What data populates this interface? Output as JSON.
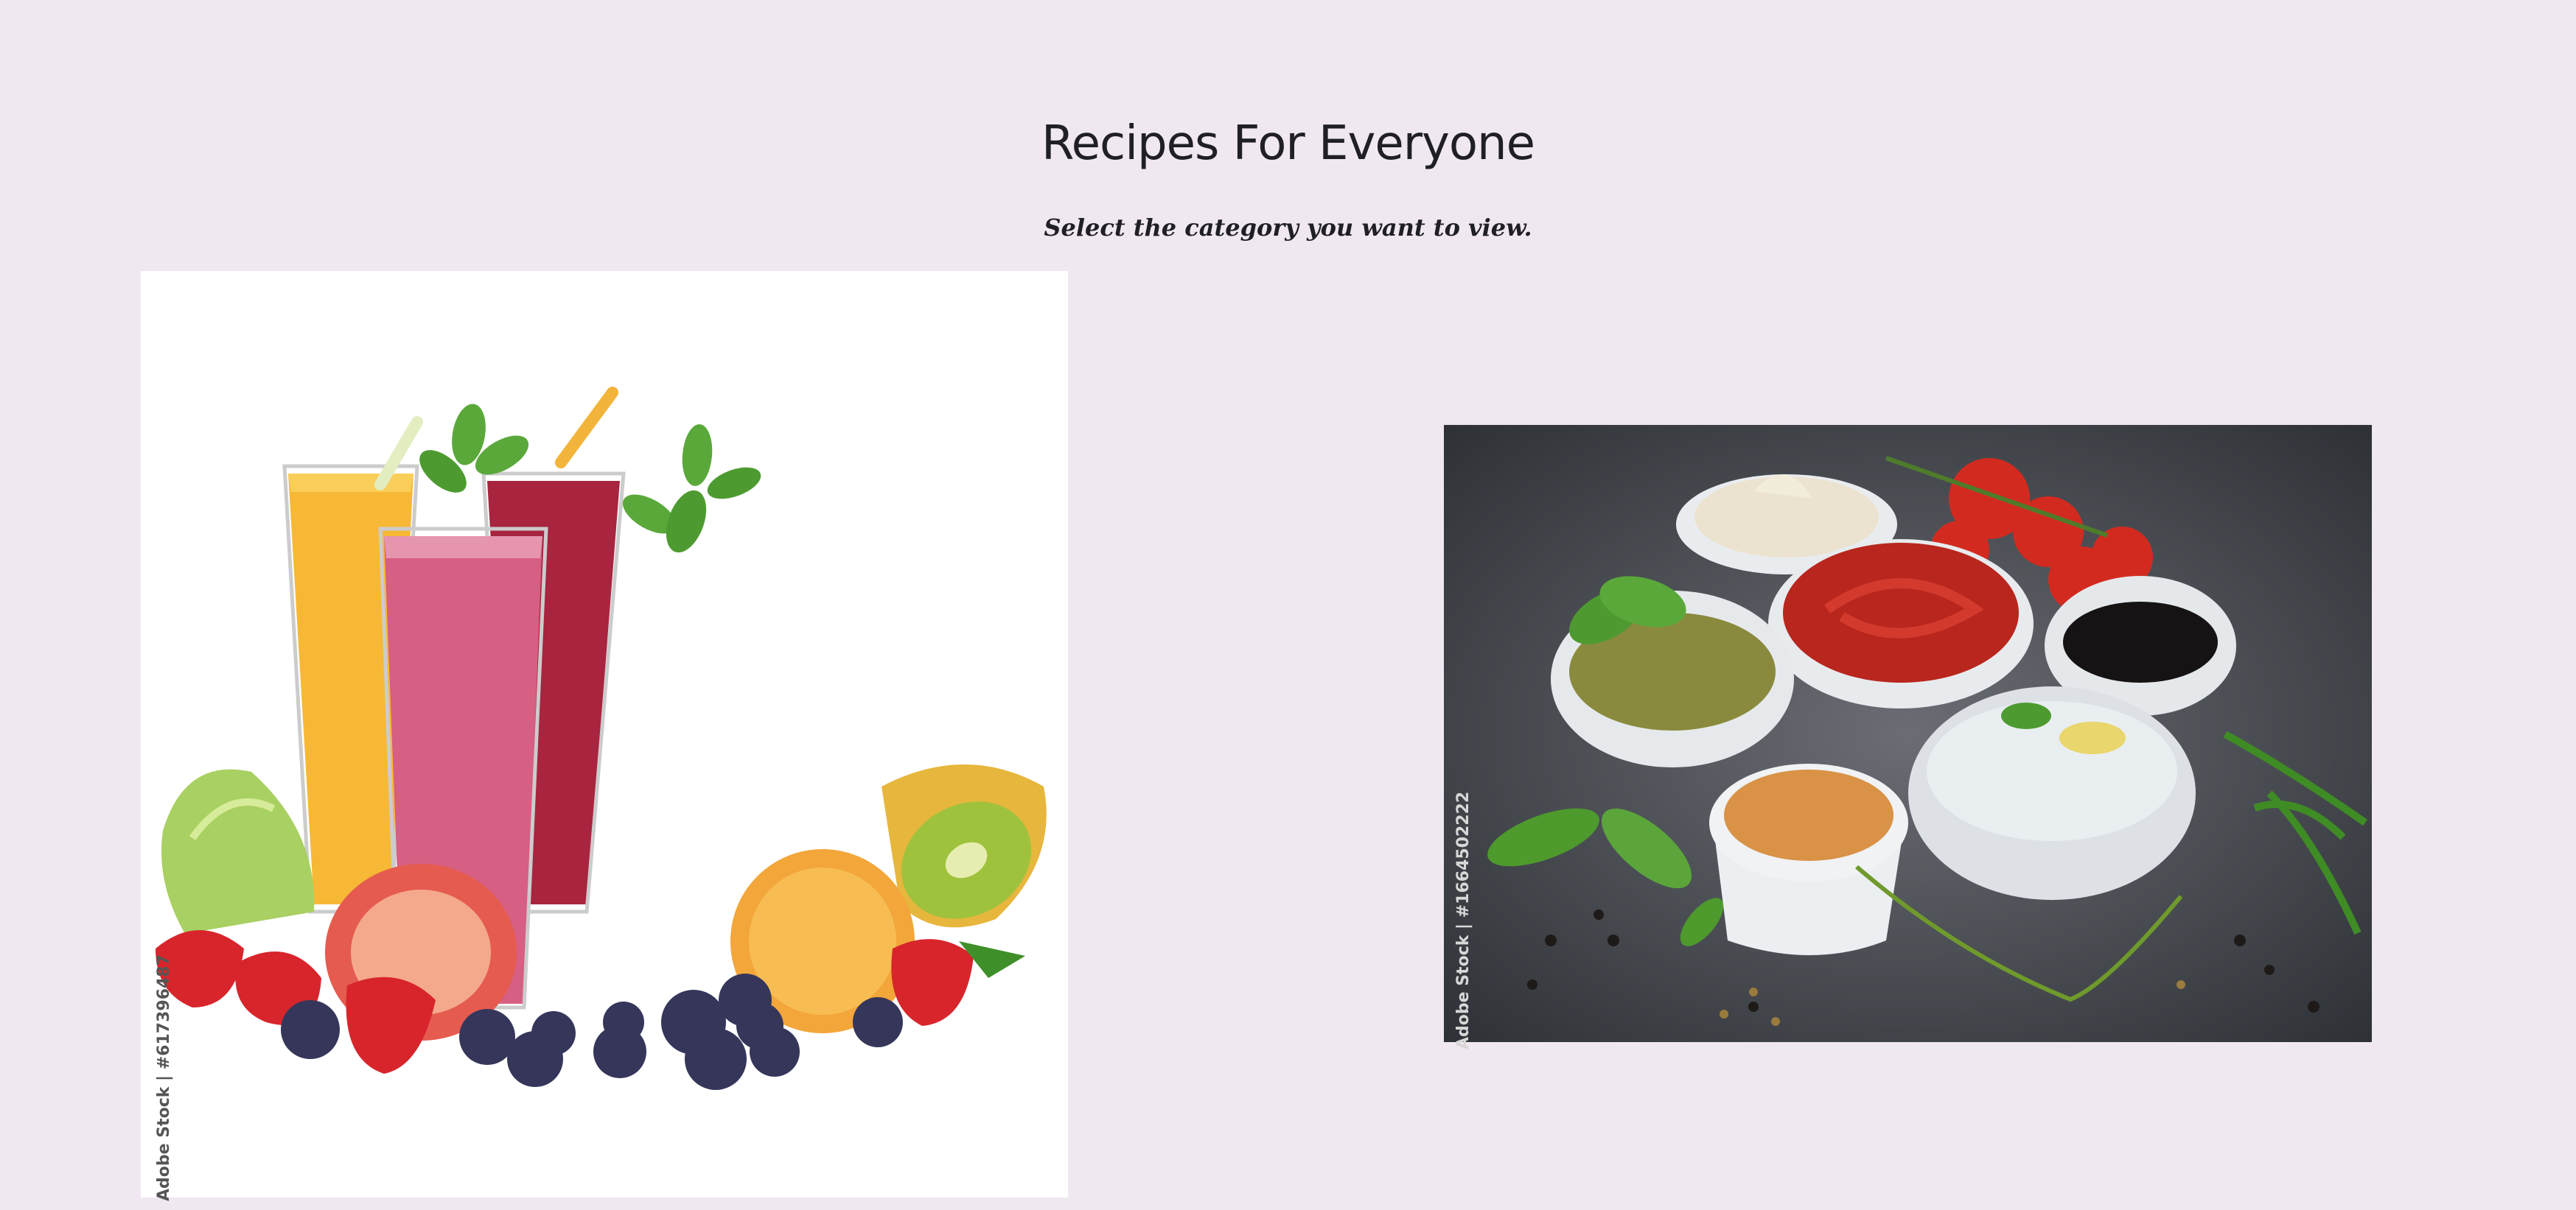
{
  "header": {
    "title": "Recipes For Everyone",
    "subtitle": "Select the category you want to view."
  },
  "categories": [
    {
      "image_description": "smoothies in glasses with fruit",
      "watermark": "Adobe Stock | #617396487"
    },
    {
      "image_description": "bowls of sauces and dips with herbs",
      "watermark": "Adobe Stock | #1664502222"
    }
  ],
  "colors": {
    "background": "#f0e8f0",
    "text": "#1f1f24"
  }
}
